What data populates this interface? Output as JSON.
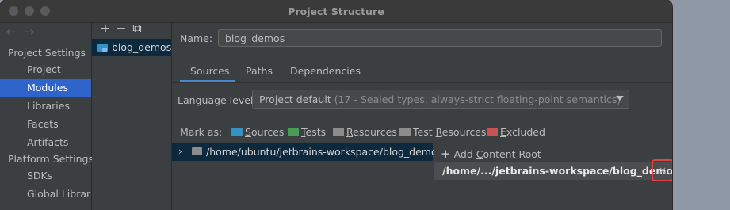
{
  "window": {
    "title": "Project Structure"
  },
  "nav": {
    "back_arrow": "←",
    "forward_arrow": "→",
    "project_settings": "Project Settings",
    "project_items": [
      "Project",
      "Modules",
      "Libraries",
      "Facets",
      "Artifacts"
    ],
    "selected": "Modules",
    "platform_settings": "Platform Settings",
    "platform_items": [
      "SDKs",
      "Global Libraries"
    ]
  },
  "modules": {
    "add": "+",
    "remove": "−",
    "copy": "⧉",
    "items": [
      "blog_demos"
    ]
  },
  "module": {
    "name_label": "Name:",
    "name_value": "blog_demos",
    "tabs": [
      "Sources",
      "Paths",
      "Dependencies"
    ],
    "active_tab": "Sources",
    "language_level_label": "Language level:",
    "language_level_value": "Project default",
    "language_level_hint": "(17 - Sealed types, always-strict floating-point semantics)",
    "mark_as_label": "Mark as:",
    "mark_as": [
      {
        "pre": "",
        "u": "S",
        "post": "ources",
        "color": "#3592c4"
      },
      {
        "pre": "",
        "u": "T",
        "post": "ests",
        "color": "#499c54"
      },
      {
        "pre": "",
        "u": "R",
        "post": "esources",
        "color": "#8c8c8c"
      },
      {
        "pre": "Test ",
        "u": "R",
        "post": "esources",
        "color": "#8c8c8c"
      },
      {
        "pre": "",
        "u": "E",
        "post": "xcluded",
        "color": "#c75450"
      }
    ],
    "tree_chevron": "›",
    "tree_root": "/home/ubuntu/jetbrains-workspace/blog_demos",
    "add_content_root_pre": "Add ",
    "add_content_root_u": "C",
    "add_content_root_post": "ontent Root",
    "content_root": "/home/.../jetbrains-workspace/blog_demos",
    "remove_root": "×"
  },
  "colors": {
    "selection": "#2f65ca",
    "tab_underline": "#4a88c7",
    "highlight_box": "#e0433f",
    "module_folder": "#3592c4"
  }
}
